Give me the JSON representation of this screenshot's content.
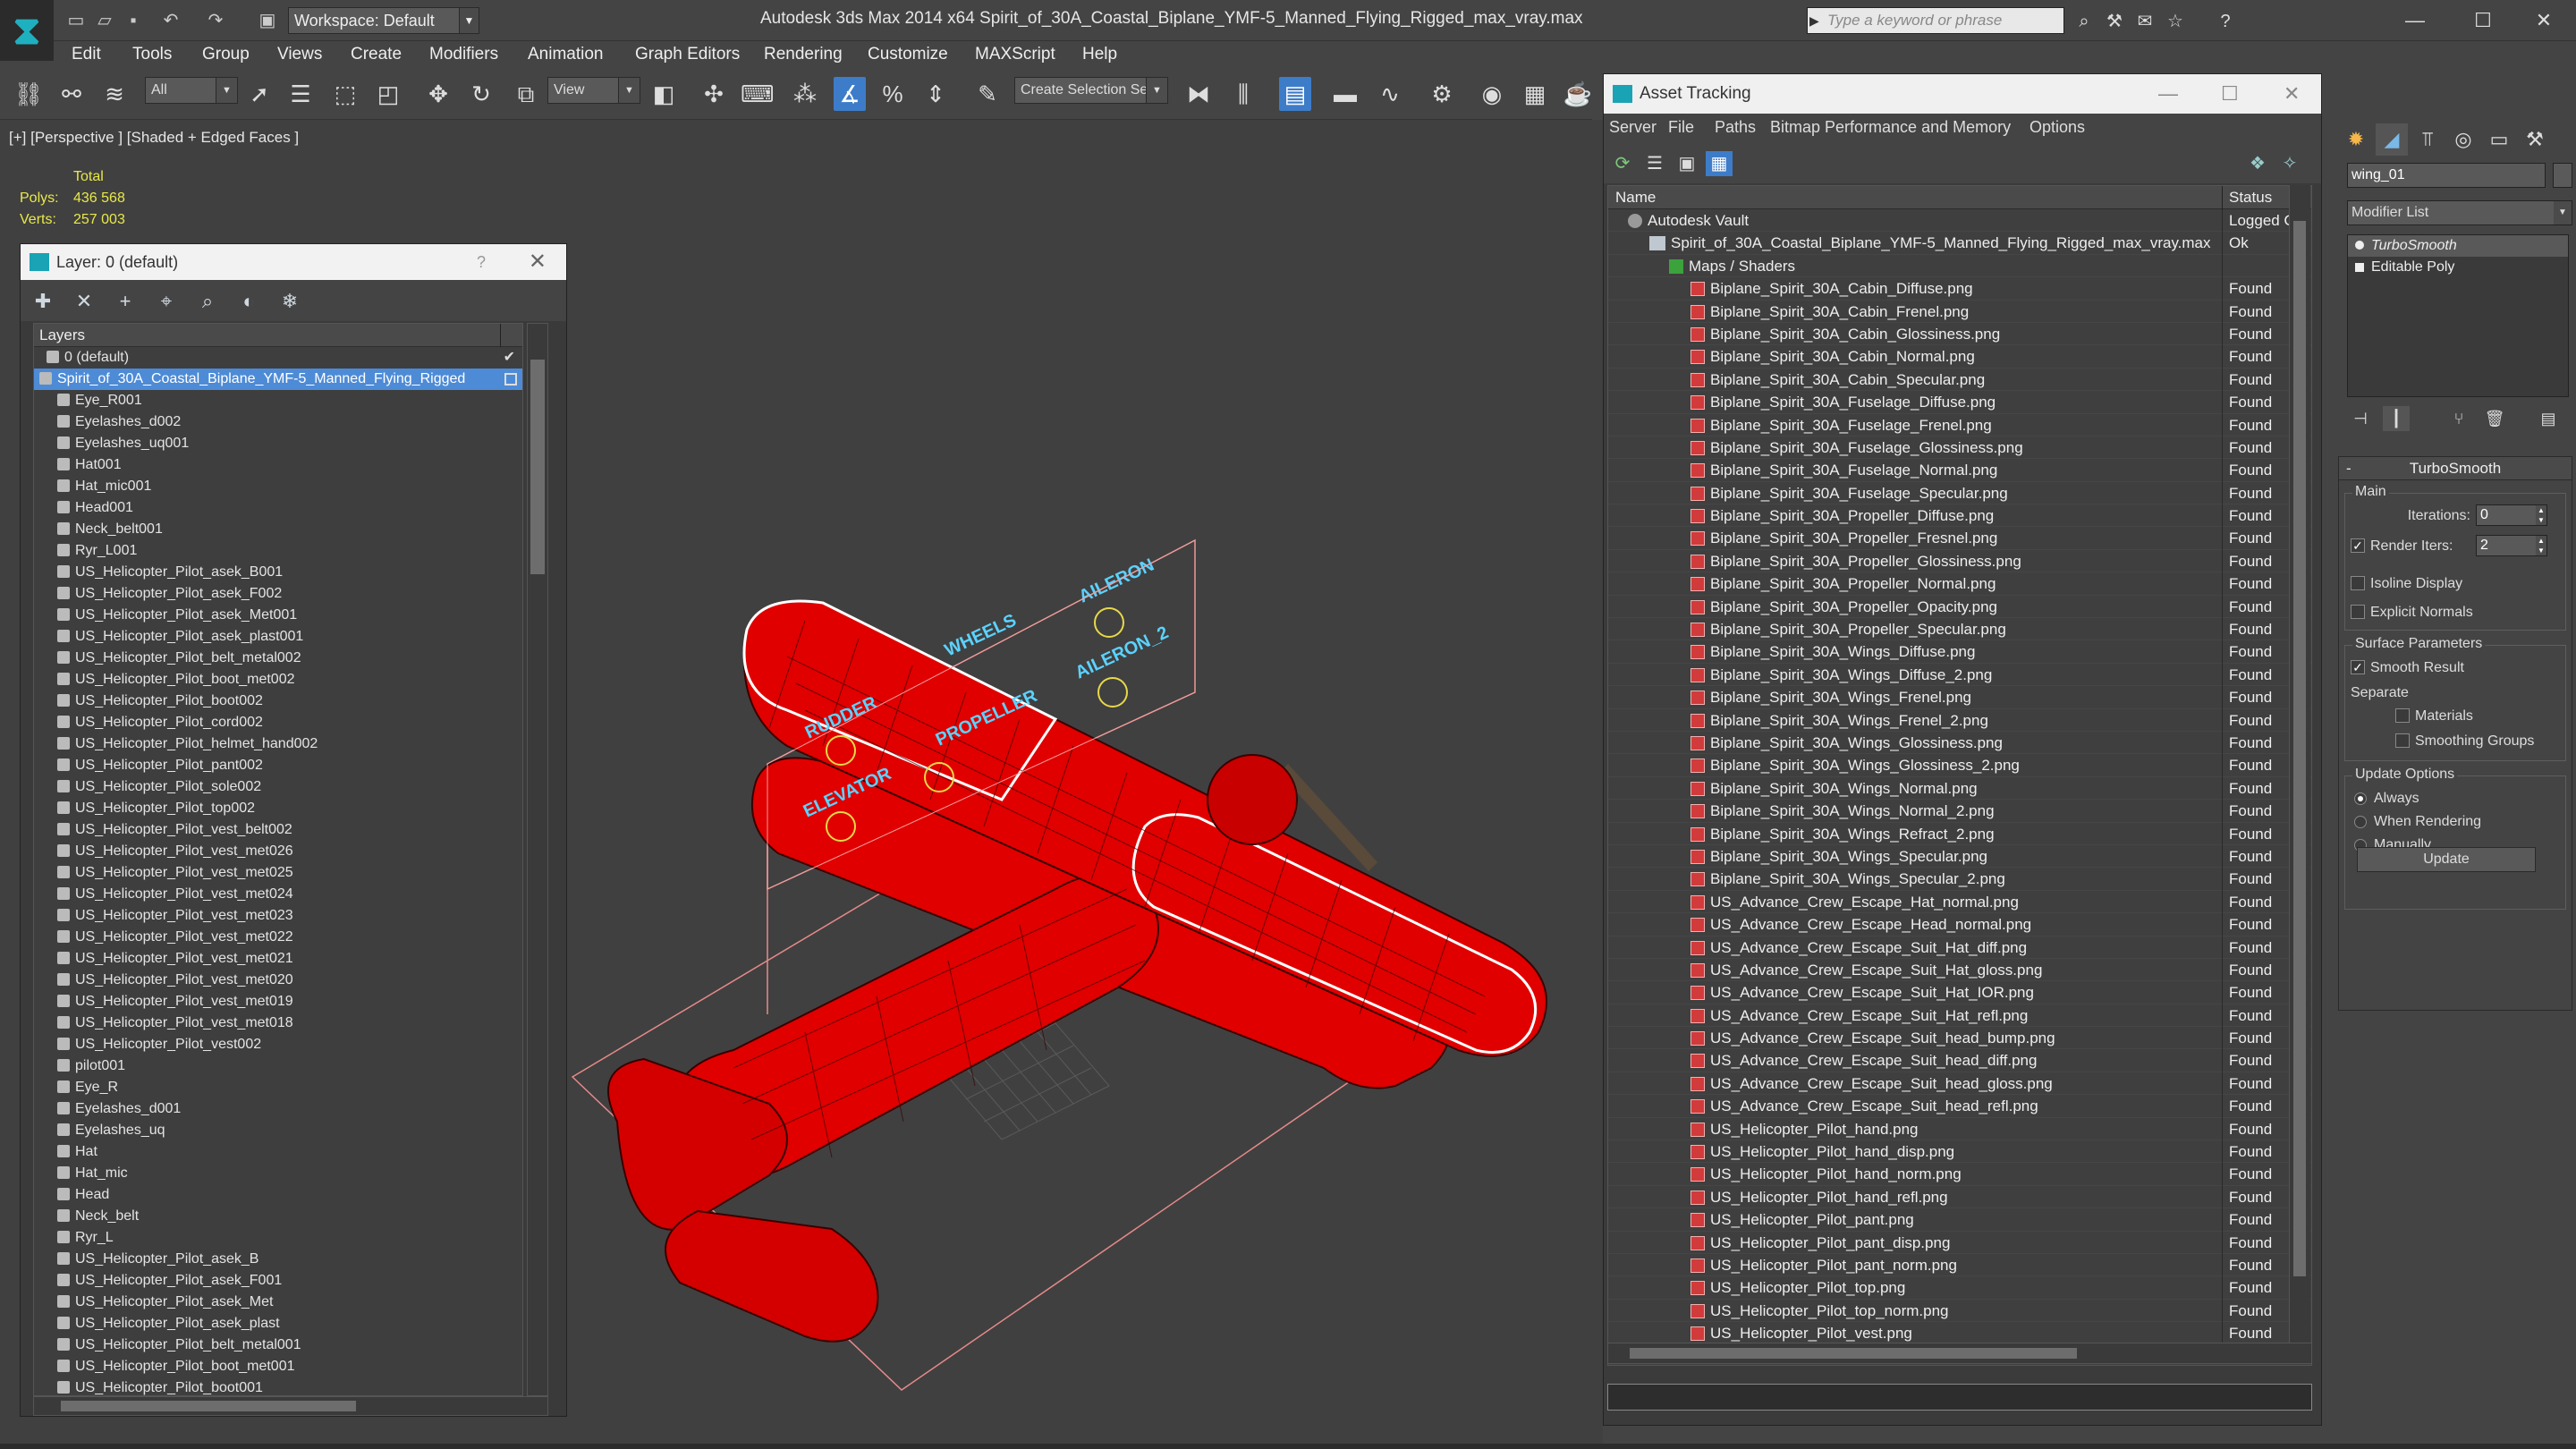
{
  "titlebar": {
    "workspace": "Workspace: Default",
    "title": "Autodesk 3ds Max 2014 x64      Spirit_of_30A_Coastal_Biplane_YMF-5_Manned_Flying_Rigged_max_vray.max",
    "search_placeholder": "Type a keyword or phrase"
  },
  "menu": [
    "Edit",
    "Tools",
    "Group",
    "Views",
    "Create",
    "Modifiers",
    "Animation",
    "Graph Editors",
    "Rendering",
    "Customize",
    "MAXScript",
    "Help"
  ],
  "toolbar": {
    "filter": "All",
    "refcoord": "View",
    "selection_set": "Create Selection Se"
  },
  "viewport": {
    "label": "[+] [Perspective ] [Shaded + Edged Faces ]",
    "stats_total": "Total",
    "polys_label": "Polys:",
    "polys_value": "436 568",
    "verts_label": "Verts:",
    "verts_value": "257 003",
    "rig_labels": [
      "AILERON",
      "AILERON_2",
      "WHEELS",
      "PROPELLER",
      "RUDDER",
      "ELEVATOR"
    ]
  },
  "layer_panel": {
    "title": "Layer: 0 (default)",
    "help": "?",
    "column": "Layers",
    "layers": [
      "0 (default)",
      "Spirit_of_30A_Coastal_Biplane_YMF-5_Manned_Flying_Rigged",
      "Eye_R001",
      "Eyelashes_d002",
      "Eyelashes_uq001",
      "Hat001",
      "Hat_mic001",
      "Head001",
      "Neck_belt001",
      "Ryr_L001",
      "US_Helicopter_Pilot_asek_B001",
      "US_Helicopter_Pilot_asek_F002",
      "US_Helicopter_Pilot_asek_Met001",
      "US_Helicopter_Pilot_asek_plast001",
      "US_Helicopter_Pilot_belt_metal002",
      "US_Helicopter_Pilot_boot_met002",
      "US_Helicopter_Pilot_boot002",
      "US_Helicopter_Pilot_cord002",
      "US_Helicopter_Pilot_helmet_hand002",
      "US_Helicopter_Pilot_pant002",
      "US_Helicopter_Pilot_sole002",
      "US_Helicopter_Pilot_top002",
      "US_Helicopter_Pilot_vest_belt002",
      "US_Helicopter_Pilot_vest_met026",
      "US_Helicopter_Pilot_vest_met025",
      "US_Helicopter_Pilot_vest_met024",
      "US_Helicopter_Pilot_vest_met023",
      "US_Helicopter_Pilot_vest_met022",
      "US_Helicopter_Pilot_vest_met021",
      "US_Helicopter_Pilot_vest_met020",
      "US_Helicopter_Pilot_vest_met019",
      "US_Helicopter_Pilot_vest_met018",
      "US_Helicopter_Pilot_vest002",
      "pilot001",
      "Eye_R",
      "Eyelashes_d001",
      "Eyelashes_uq",
      "Hat",
      "Hat_mic",
      "Head",
      "Neck_belt",
      "Ryr_L",
      "US_Helicopter_Pilot_asek_B",
      "US_Helicopter_Pilot_asek_F001",
      "US_Helicopter_Pilot_asek_Met",
      "US_Helicopter_Pilot_asek_plast",
      "US_Helicopter_Pilot_belt_metal001",
      "US_Helicopter_Pilot_boot_met001",
      "US_Helicopter_Pilot_boot001"
    ]
  },
  "asset_tracking": {
    "title": "Asset Tracking",
    "menu": [
      "Server",
      "File",
      "Paths",
      "Bitmap Performance and Memory",
      "Options"
    ],
    "col_name": "Name",
    "col_status": "Status",
    "rows": [
      {
        "name": "Autodesk Vault",
        "status": "Logged O",
        "kind": "vault"
      },
      {
        "name": "Spirit_of_30A_Coastal_Biplane_YMF-5_Manned_Flying_Rigged_max_vray.max",
        "status": "Ok",
        "kind": "max"
      },
      {
        "name": "Maps / Shaders",
        "status": "",
        "kind": "maps"
      },
      {
        "name": "Biplane_Spirit_30A_Cabin_Diffuse.png",
        "status": "Found",
        "kind": "png"
      },
      {
        "name": "Biplane_Spirit_30A_Cabin_Frenel.png",
        "status": "Found",
        "kind": "png"
      },
      {
        "name": "Biplane_Spirit_30A_Cabin_Glossiness.png",
        "status": "Found",
        "kind": "png"
      },
      {
        "name": "Biplane_Spirit_30A_Cabin_Normal.png",
        "status": "Found",
        "kind": "png"
      },
      {
        "name": "Biplane_Spirit_30A_Cabin_Specular.png",
        "status": "Found",
        "kind": "png"
      },
      {
        "name": "Biplane_Spirit_30A_Fuselage_Diffuse.png",
        "status": "Found",
        "kind": "png"
      },
      {
        "name": "Biplane_Spirit_30A_Fuselage_Frenel.png",
        "status": "Found",
        "kind": "png"
      },
      {
        "name": "Biplane_Spirit_30A_Fuselage_Glossiness.png",
        "status": "Found",
        "kind": "png"
      },
      {
        "name": "Biplane_Spirit_30A_Fuselage_Normal.png",
        "status": "Found",
        "kind": "png"
      },
      {
        "name": "Biplane_Spirit_30A_Fuselage_Specular.png",
        "status": "Found",
        "kind": "png"
      },
      {
        "name": "Biplane_Spirit_30A_Propeller_Diffuse.png",
        "status": "Found",
        "kind": "png"
      },
      {
        "name": "Biplane_Spirit_30A_Propeller_Fresnel.png",
        "status": "Found",
        "kind": "png"
      },
      {
        "name": "Biplane_Spirit_30A_Propeller_Glossiness.png",
        "status": "Found",
        "kind": "png"
      },
      {
        "name": "Biplane_Spirit_30A_Propeller_Normal.png",
        "status": "Found",
        "kind": "png"
      },
      {
        "name": "Biplane_Spirit_30A_Propeller_Opacity.png",
        "status": "Found",
        "kind": "png"
      },
      {
        "name": "Biplane_Spirit_30A_Propeller_Specular.png",
        "status": "Found",
        "kind": "png"
      },
      {
        "name": "Biplane_Spirit_30A_Wings_Diffuse.png",
        "status": "Found",
        "kind": "png"
      },
      {
        "name": "Biplane_Spirit_30A_Wings_Diffuse_2.png",
        "status": "Found",
        "kind": "png"
      },
      {
        "name": "Biplane_Spirit_30A_Wings_Frenel.png",
        "status": "Found",
        "kind": "png"
      },
      {
        "name": "Biplane_Spirit_30A_Wings_Frenel_2.png",
        "status": "Found",
        "kind": "png"
      },
      {
        "name": "Biplane_Spirit_30A_Wings_Glossiness.png",
        "status": "Found",
        "kind": "png"
      },
      {
        "name": "Biplane_Spirit_30A_Wings_Glossiness_2.png",
        "status": "Found",
        "kind": "png"
      },
      {
        "name": "Biplane_Spirit_30A_Wings_Normal.png",
        "status": "Found",
        "kind": "png"
      },
      {
        "name": "Biplane_Spirit_30A_Wings_Normal_2.png",
        "status": "Found",
        "kind": "png"
      },
      {
        "name": "Biplane_Spirit_30A_Wings_Refract_2.png",
        "status": "Found",
        "kind": "png"
      },
      {
        "name": "Biplane_Spirit_30A_Wings_Specular.png",
        "status": "Found",
        "kind": "png"
      },
      {
        "name": "Biplane_Spirit_30A_Wings_Specular_2.png",
        "status": "Found",
        "kind": "png"
      },
      {
        "name": "US_Advance_Crew_Escape_Hat_normal.png",
        "status": "Found",
        "kind": "png"
      },
      {
        "name": "US_Advance_Crew_Escape_Head_normal.png",
        "status": "Found",
        "kind": "png"
      },
      {
        "name": "US_Advance_Crew_Escape_Suit_Hat_diff.png",
        "status": "Found",
        "kind": "png"
      },
      {
        "name": "US_Advance_Crew_Escape_Suit_Hat_gloss.png",
        "status": "Found",
        "kind": "png"
      },
      {
        "name": "US_Advance_Crew_Escape_Suit_Hat_IOR.png",
        "status": "Found",
        "kind": "png"
      },
      {
        "name": "US_Advance_Crew_Escape_Suit_Hat_refl.png",
        "status": "Found",
        "kind": "png"
      },
      {
        "name": "US_Advance_Crew_Escape_Suit_head_bump.png",
        "status": "Found",
        "kind": "png"
      },
      {
        "name": "US_Advance_Crew_Escape_Suit_head_diff.png",
        "status": "Found",
        "kind": "png"
      },
      {
        "name": "US_Advance_Crew_Escape_Suit_head_gloss.png",
        "status": "Found",
        "kind": "png"
      },
      {
        "name": "US_Advance_Crew_Escape_Suit_head_refl.png",
        "status": "Found",
        "kind": "png"
      },
      {
        "name": "US_Helicopter_Pilot_hand.png",
        "status": "Found",
        "kind": "png"
      },
      {
        "name": "US_Helicopter_Pilot_hand_disp.png",
        "status": "Found",
        "kind": "png"
      },
      {
        "name": "US_Helicopter_Pilot_hand_norm.png",
        "status": "Found",
        "kind": "png"
      },
      {
        "name": "US_Helicopter_Pilot_hand_refl.png",
        "status": "Found",
        "kind": "png"
      },
      {
        "name": "US_Helicopter_Pilot_pant.png",
        "status": "Found",
        "kind": "png"
      },
      {
        "name": "US_Helicopter_Pilot_pant_disp.png",
        "status": "Found",
        "kind": "png"
      },
      {
        "name": "US_Helicopter_Pilot_pant_norm.png",
        "status": "Found",
        "kind": "png"
      },
      {
        "name": "US_Helicopter_Pilot_top.png",
        "status": "Found",
        "kind": "png"
      },
      {
        "name": "US_Helicopter_Pilot_top_norm.png",
        "status": "Found",
        "kind": "png"
      },
      {
        "name": "US_Helicopter_Pilot_vest.png",
        "status": "Found",
        "kind": "png"
      }
    ]
  },
  "command_panel": {
    "object_name": "wing_01",
    "modifier_list": "Modifier List",
    "stack": [
      "TurboSmooth",
      "Editable Poly"
    ],
    "rollout_title": "TurboSmooth",
    "main_group": "Main",
    "iterations_label": "Iterations:",
    "iterations_value": "0",
    "render_iters_label": "Render Iters:",
    "render_iters_value": "2",
    "isoline_label": "Isoline Display",
    "explicit_label": "Explicit Normals",
    "surface_group": "Surface Parameters",
    "smooth_label": "Smooth Result",
    "separate_label": "Separate",
    "materials_label": "Materials",
    "smoothing_groups_label": "Smoothing Groups",
    "update_group": "Update Options",
    "always_label": "Always",
    "when_rendering_label": "When Rendering",
    "manually_label": "Manually",
    "update_button": "Update"
  },
  "colors": {
    "accent": "#3d7cc8",
    "model_red": "#e00000",
    "stats_yellow": "#e8e84a"
  }
}
